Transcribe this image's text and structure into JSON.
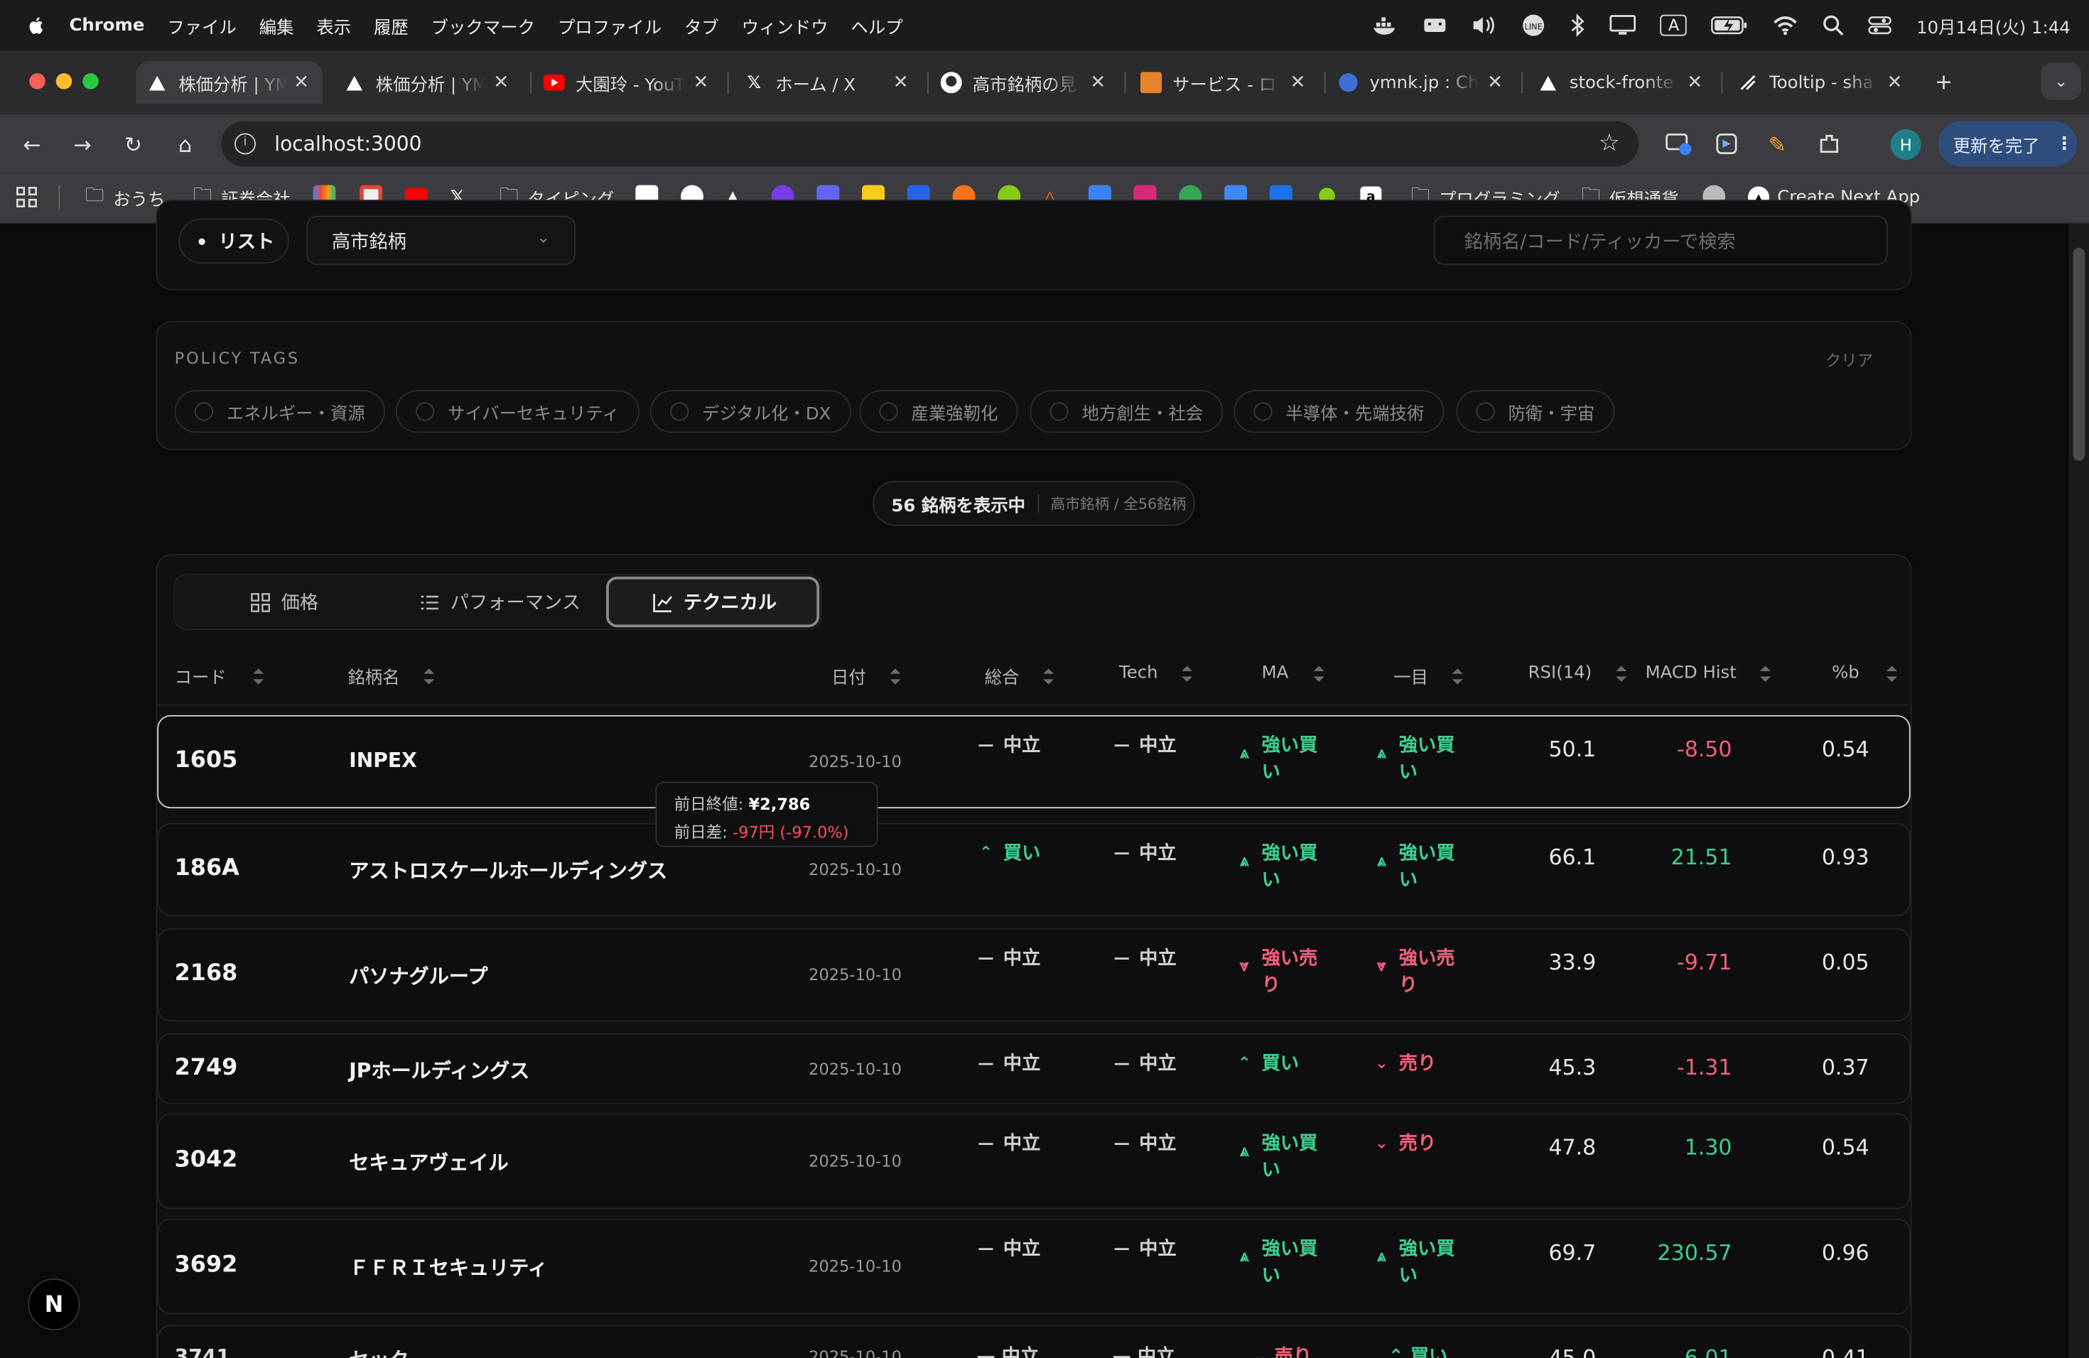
{
  "menubar": {
    "app": "Chrome",
    "items": [
      "ファイル",
      "編集",
      "表示",
      "履歴",
      "ブックマーク",
      "プロファイル",
      "タブ",
      "ウィンドウ",
      "ヘルプ"
    ],
    "ime": "A",
    "clock": "10月14日(火) 1:44"
  },
  "tabs": [
    {
      "title": "株価分析 | YM"
    },
    {
      "title": "株価分析 | YM"
    },
    {
      "title": "大園玲 - YouTube"
    },
    {
      "title": "ホーム / X"
    },
    {
      "title": "高市銘柄の見"
    },
    {
      "title": "サービス - ロ"
    },
    {
      "title": "ymnk.jp : Ch"
    },
    {
      "title": "stock-fronte"
    },
    {
      "title": "Tooltip - sha"
    }
  ],
  "toolbar": {
    "url": "localhost:3000",
    "update_button": "更新を完了",
    "profile": "H"
  },
  "bookmarks": [
    "おうち",
    "証券会社",
    "タイピング",
    "プログラミング",
    "仮想通貨",
    "Create Next App"
  ],
  "filters": {
    "mode_label": "リスト",
    "list_value": "高市銘柄",
    "search_placeholder": "銘柄名/コード/ティッカーで検索"
  },
  "policy": {
    "title": "POLICY TAGS",
    "clear": "クリア",
    "tags": [
      "エネルギー・資源",
      "サイバーセキュリティ",
      "デジタル化・DX",
      "産業強靭化",
      "地方創生・社会",
      "半導体・先端技術",
      "防衛・宇宙"
    ]
  },
  "summary": {
    "count_text": "56 銘柄を表示中",
    "detail": "高市銘柄 / 全56銘柄"
  },
  "view_tabs": [
    "価格",
    "パフォーマンス",
    "テクニカル"
  ],
  "columns": [
    "コード",
    "銘柄名",
    "日付",
    "総合",
    "Tech",
    "MA",
    "一目",
    "RSI(14)",
    "MACD Hist",
    "%b"
  ],
  "rows": [
    {
      "code": "1605",
      "name": "INPEX",
      "date": "2025-10-10",
      "overall": "中立",
      "tech": "中立",
      "ma": "強い買い",
      "ichimoku": "強い買い",
      "rsi": "50.1",
      "macd": "-8.50",
      "pb": "0.54"
    },
    {
      "code": "186A",
      "name": "アストロスケールホールディングス",
      "date": "2025-10-10",
      "overall": "買い",
      "tech": "中立",
      "ma": "強い買い",
      "ichimoku": "強い買い",
      "rsi": "66.1",
      "macd": "21.51",
      "pb": "0.93"
    },
    {
      "code": "2168",
      "name": "パソナグループ",
      "date": "2025-10-10",
      "overall": "中立",
      "tech": "中立",
      "ma": "強い売り",
      "ichimoku": "強い売り",
      "rsi": "33.9",
      "macd": "-9.71",
      "pb": "0.05"
    },
    {
      "code": "2749",
      "name": "JPホールディングス",
      "date": "2025-10-10",
      "overall": "中立",
      "tech": "中立",
      "ma": "買い",
      "ichimoku": "売り",
      "rsi": "45.3",
      "macd": "-1.31",
      "pb": "0.37"
    },
    {
      "code": "3042",
      "name": "セキュアヴェイル",
      "date": "2025-10-10",
      "overall": "中立",
      "tech": "中立",
      "ma": "強い買い",
      "ichimoku": "売り",
      "rsi": "47.8",
      "macd": "1.30",
      "pb": "0.54"
    },
    {
      "code": "3692",
      "name": "ＦＦＲＩセキュリティ",
      "date": "2025-10-10",
      "overall": "中立",
      "tech": "中立",
      "ma": "強い買い",
      "ichimoku": "強い買い",
      "rsi": "69.7",
      "macd": "230.57",
      "pb": "0.96"
    }
  ],
  "tooltip": {
    "prev_close_label": "前日終値:",
    "prev_close": "¥2,786",
    "diff_label": "前日差:",
    "diff": "-97円 (-97.0%)"
  },
  "dev_badge": "N",
  "colors": {
    "buy": "#3ecf8e",
    "sell": "#f0607a",
    "neutral": "#cfcfd4",
    "accent": "#2f4d7c"
  }
}
